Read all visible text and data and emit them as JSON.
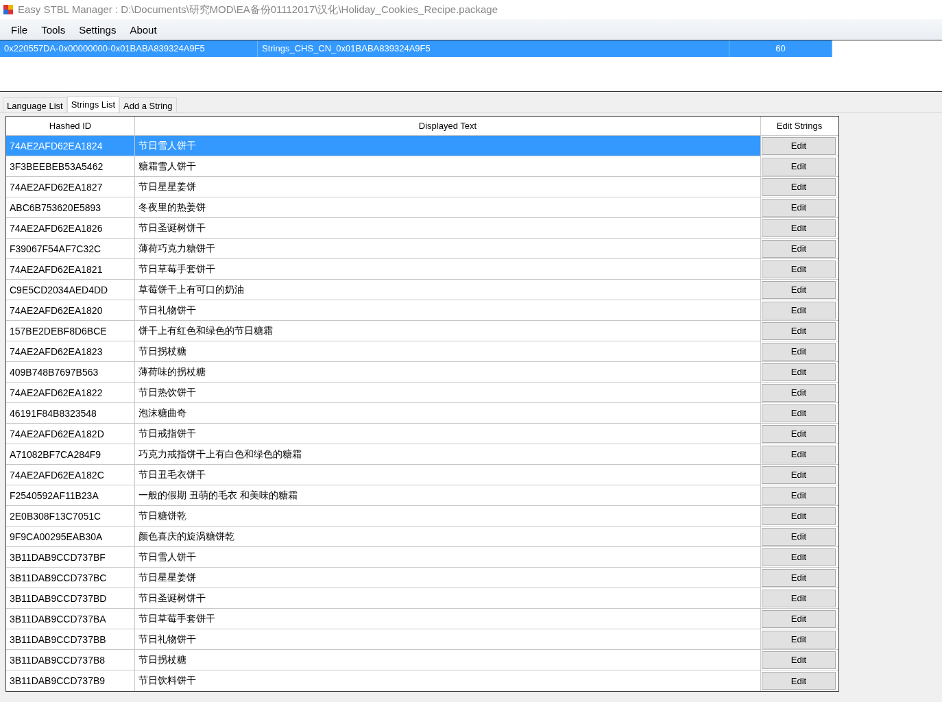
{
  "window": {
    "title": "Easy STBL Manager : D:\\Documents\\研究MOD\\EA备份01112017\\汉化\\Holiday_Cookies_Recipe.package"
  },
  "menu": [
    "File",
    "Tools",
    "Settings",
    "About"
  ],
  "packages": {
    "rows": [
      {
        "instance": "0x220557DA-0x00000000-0x01BABA839324A9F5",
        "name": "Strings_CHS_CN_0x01BABA839324A9F5",
        "count": "60",
        "selected": true
      }
    ]
  },
  "tabs": [
    {
      "label": "Language List",
      "selected": false
    },
    {
      "label": "Strings List",
      "selected": true
    },
    {
      "label": "Add a String",
      "selected": false
    }
  ],
  "table": {
    "columns": [
      "Hashed ID",
      "Displayed Text",
      "Edit Strings"
    ],
    "rows": [
      {
        "id": "74AE2AFD62EA1824",
        "text": "节日雪人饼干",
        "button": "Edit",
        "selected": true
      },
      {
        "id": "3F3BEEBEB53A5462",
        "text": "糖霜雪人饼干",
        "button": "Edit",
        "selected": false
      },
      {
        "id": "74AE2AFD62EA1827",
        "text": "节日星星姜饼",
        "button": "Edit",
        "selected": false
      },
      {
        "id": "ABC6B753620E5893",
        "text": "冬夜里的热姜饼",
        "button": "Edit",
        "selected": false
      },
      {
        "id": "74AE2AFD62EA1826",
        "text": "节日圣诞树饼干",
        "button": "Edit",
        "selected": false
      },
      {
        "id": "F39067F54AF7C32C",
        "text": "薄荷巧克力糖饼干",
        "button": "Edit",
        "selected": false
      },
      {
        "id": "74AE2AFD62EA1821",
        "text": "节日草莓手套饼干",
        "button": "Edit",
        "selected": false
      },
      {
        "id": "C9E5CD2034AED4DD",
        "text": "草莓饼干上有可口的奶油",
        "button": "Edit",
        "selected": false
      },
      {
        "id": "74AE2AFD62EA1820",
        "text": "节日礼物饼干",
        "button": "Edit",
        "selected": false
      },
      {
        "id": "157BE2DEBF8D6BCE",
        "text": "饼干上有红色和绿色的节日糖霜",
        "button": "Edit",
        "selected": false
      },
      {
        "id": "74AE2AFD62EA1823",
        "text": "节日拐杖糖",
        "button": "Edit",
        "selected": false
      },
      {
        "id": "409B748B7697B563",
        "text": "薄荷味的拐杖糖",
        "button": "Edit",
        "selected": false
      },
      {
        "id": "74AE2AFD62EA1822",
        "text": "节日热饮饼干",
        "button": "Edit",
        "selected": false
      },
      {
        "id": "46191F84B8323548",
        "text": "泡沫糖曲奇",
        "button": "Edit",
        "selected": false
      },
      {
        "id": "74AE2AFD62EA182D",
        "text": "节日戒指饼干",
        "button": "Edit",
        "selected": false
      },
      {
        "id": "A71082BF7CA284F9",
        "text": "巧克力戒指饼干上有白色和绿色的糖霜",
        "button": "Edit",
        "selected": false
      },
      {
        "id": "74AE2AFD62EA182C",
        "text": "节日丑毛衣饼干",
        "button": "Edit",
        "selected": false
      },
      {
        "id": "F2540592AF11B23A",
        "text": "一般的假期 丑萌的毛衣 和美味的糖霜",
        "button": "Edit",
        "selected": false
      },
      {
        "id": "2E0B308F13C7051C",
        "text": "节日糖饼乾",
        "button": "Edit",
        "selected": false
      },
      {
        "id": "9F9CA00295EAB30A",
        "text": "颜色喜庆的旋涡糖饼乾",
        "button": "Edit",
        "selected": false
      },
      {
        "id": "3B11DAB9CCD737BF",
        "text": "节日雪人饼干",
        "button": "Edit",
        "selected": false
      },
      {
        "id": "3B11DAB9CCD737BC",
        "text": "节日星星姜饼",
        "button": "Edit",
        "selected": false
      },
      {
        "id": "3B11DAB9CCD737BD",
        "text": "节日圣诞树饼干",
        "button": "Edit",
        "selected": false
      },
      {
        "id": "3B11DAB9CCD737BA",
        "text": "节日草莓手套饼干",
        "button": "Edit",
        "selected": false
      },
      {
        "id": "3B11DAB9CCD737BB",
        "text": "节日礼物饼干",
        "button": "Edit",
        "selected": false
      },
      {
        "id": "3B11DAB9CCD737B8",
        "text": "节日拐杖糖",
        "button": "Edit",
        "selected": false
      },
      {
        "id": "3B11DAB9CCD737B9",
        "text": "节日饮料饼干",
        "button": "Edit",
        "selected": false
      }
    ]
  }
}
